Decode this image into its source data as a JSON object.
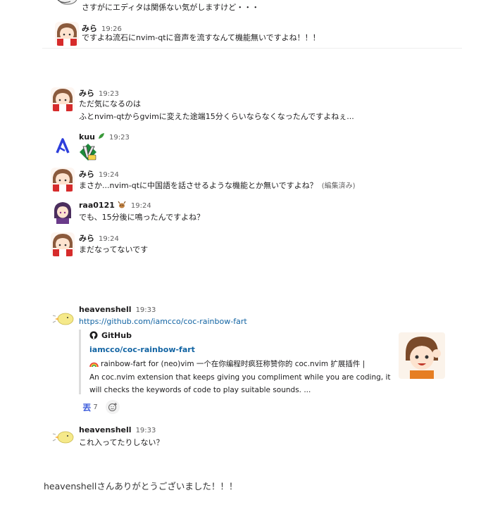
{
  "top": {
    "partial_text": "さすがにエディタは関係ない気がしますけど・・・",
    "msg": {
      "user": "みら",
      "time": "19:26",
      "text": "ですよね流石にnvim-qtに音声を流すなんて機能無いですよね！！！"
    }
  },
  "middle": [
    {
      "user": "みら",
      "time": "19:23",
      "lines": [
        "ただ気になるのは",
        "ふとnvim-qtからgvimに変えた途端15分くらいならなくなったんですよねぇ..."
      ]
    },
    {
      "user": "kuu",
      "time": "19:23",
      "lines": []
    },
    {
      "user": "みら",
      "time": "19:24",
      "lines": [
        "まさか...nvim-qtに中国語を話させるような機能とか無いですよね？"
      ],
      "edited": "(編集済み)"
    },
    {
      "user": "raa0121",
      "time": "19:24",
      "lines": [
        "でも、15分後に鳴ったんですよね？"
      ]
    },
    {
      "user": "みら",
      "time": "19:24",
      "lines": [
        "まだなってないです"
      ]
    }
  ],
  "bottom": {
    "msg1": {
      "user": "heavenshell",
      "time": "19:33",
      "link": "https://github.com/iamcco/coc-rainbow-fart",
      "attachment": {
        "source": "GitHub",
        "title": "iamcco/coc-rainbow-fart",
        "desc_lines": [
          "rainbow-fart for (neo)vim 一个在你编程时疯狂称赞你的 coc.nvim 扩展插件 |",
          "An coc.nvim extension that keeps giving you compliment while you are coding, it",
          "will checks the keywords of code to play suitable sounds. ..."
        ]
      },
      "reactions": [
        {
          "glyph": "丟",
          "count": "7"
        }
      ]
    },
    "msg2": {
      "user": "heavenshell",
      "time": "19:33",
      "text": "これ入ってたりしない？"
    }
  },
  "footer": "heavenshellさんありがとうございました！！！",
  "colors": {
    "link": "#1264a3",
    "text": "#1d1c1d",
    "muted": "#616061"
  }
}
